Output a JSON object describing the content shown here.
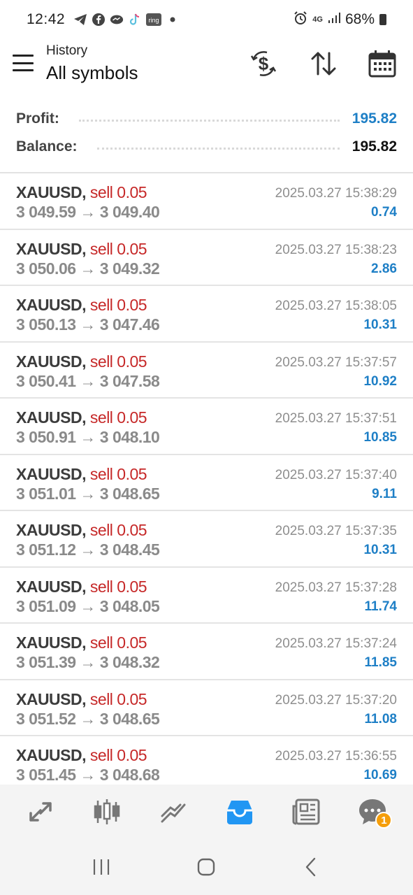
{
  "status_bar": {
    "time": "12:42",
    "left_icons": [
      "telegram-icon",
      "facebook-icon",
      "messenger-icon",
      "tiktok-icon",
      "ring-icon",
      "dot-icon"
    ],
    "ring_label": "ring",
    "network": "4G",
    "battery": "68%"
  },
  "header": {
    "subtitle": "History",
    "title": "All symbols",
    "buttons": [
      "currency-exchange-icon",
      "sort-icon",
      "calendar-icon"
    ]
  },
  "summary": {
    "profit_label": "Profit:",
    "profit_value": "195.82",
    "balance_label": "Balance:",
    "balance_value": "195.82"
  },
  "deals": [
    {
      "symbol": "XAUUSD,",
      "type": "sell 0.05",
      "prices": "3 049.59 → 3 049.40",
      "time": "2025.03.27 15:38:29",
      "profit": "0.74"
    },
    {
      "symbol": "XAUUSD,",
      "type": "sell 0.05",
      "prices": "3 050.06 → 3 049.32",
      "time": "2025.03.27 15:38:23",
      "profit": "2.86"
    },
    {
      "symbol": "XAUUSD,",
      "type": "sell 0.05",
      "prices": "3 050.13 → 3 047.46",
      "time": "2025.03.27 15:38:05",
      "profit": "10.31"
    },
    {
      "symbol": "XAUUSD,",
      "type": "sell 0.05",
      "prices": "3 050.41 → 3 047.58",
      "time": "2025.03.27 15:37:57",
      "profit": "10.92"
    },
    {
      "symbol": "XAUUSD,",
      "type": "sell 0.05",
      "prices": "3 050.91 → 3 048.10",
      "time": "2025.03.27 15:37:51",
      "profit": "10.85"
    },
    {
      "symbol": "XAUUSD,",
      "type": "sell 0.05",
      "prices": "3 051.01 → 3 048.65",
      "time": "2025.03.27 15:37:40",
      "profit": "9.11"
    },
    {
      "symbol": "XAUUSD,",
      "type": "sell 0.05",
      "prices": "3 051.12 → 3 048.45",
      "time": "2025.03.27 15:37:35",
      "profit": "10.31"
    },
    {
      "symbol": "XAUUSD,",
      "type": "sell 0.05",
      "prices": "3 051.09 → 3 048.05",
      "time": "2025.03.27 15:37:28",
      "profit": "11.74"
    },
    {
      "symbol": "XAUUSD,",
      "type": "sell 0.05",
      "prices": "3 051.39 → 3 048.32",
      "time": "2025.03.27 15:37:24",
      "profit": "11.85"
    },
    {
      "symbol": "XAUUSD,",
      "type": "sell 0.05",
      "prices": "3 051.52 → 3 048.65",
      "time": "2025.03.27 15:37:20",
      "profit": "11.08"
    },
    {
      "symbol": "XAUUSD,",
      "type": "sell 0.05",
      "prices": "3 051.45 → 3 048.68",
      "time": "2025.03.27 15:36:55",
      "profit": "10.69"
    }
  ],
  "bottom_nav": {
    "items": [
      "quotes-icon",
      "chart-icon",
      "trade-icon",
      "history-icon",
      "news-icon",
      "chat-icon"
    ],
    "active": "history-icon",
    "chat_badge": "1"
  },
  "system_nav": [
    "recent-apps-icon",
    "home-icon",
    "back-icon"
  ],
  "colors": {
    "sell": "#c62828",
    "profit": "#1e7fc6",
    "accent": "#2196f3",
    "badge": "#f59e0b"
  }
}
